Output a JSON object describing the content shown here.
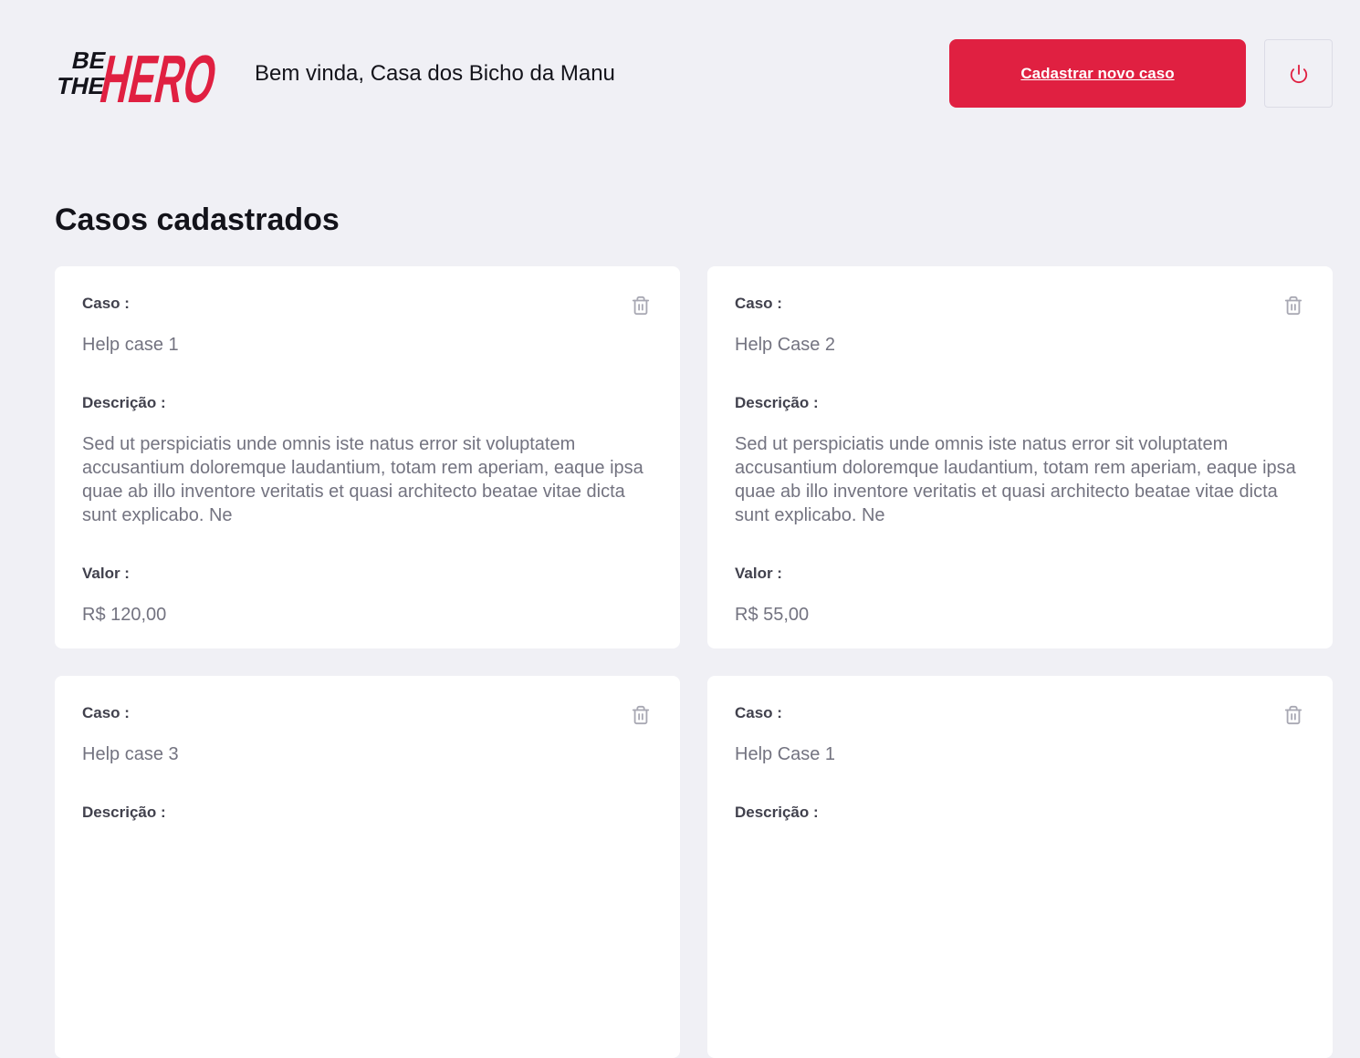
{
  "logo": {
    "line1": "BE",
    "line2": "THE",
    "line3": "HERO"
  },
  "header": {
    "welcome": "Bem vinda, Casa dos Bicho da Manu",
    "new_case_label": "Cadastrar novo caso",
    "logout_icon": "power-icon"
  },
  "page": {
    "title": "Casos cadastrados"
  },
  "cases": [
    {
      "case_label": "Caso :",
      "title": "Help case 1",
      "description_label": "Descrição :",
      "description": "Sed ut perspiciatis unde omnis iste natus error sit voluptatem accusantium doloremque laudantium, totam rem aperiam, eaque ipsa quae ab illo inventore veritatis et quasi architecto beatae vitae dicta sunt explicabo. Ne",
      "value_label": "Valor :",
      "value": "R$ 120,00"
    },
    {
      "case_label": "Caso :",
      "title": "Help Case 2",
      "description_label": "Descrição :",
      "description": "Sed ut perspiciatis unde omnis iste natus error sit voluptatem accusantium doloremque laudantium, totam rem aperiam, eaque ipsa quae ab illo inventore veritatis et quasi architecto beatae vitae dicta sunt explicabo. Ne",
      "value_label": "Valor :",
      "value": "R$ 55,00"
    },
    {
      "case_label": "Caso :",
      "title": "Help case 3",
      "description_label": "Descrição :"
    },
    {
      "case_label": "Caso :",
      "title": "Help Case 1",
      "description_label": "Descrição :"
    }
  ],
  "colors": {
    "background": "#f0f0f5",
    "accent": "#e02041",
    "card": "#ffffff",
    "label": "#41414d",
    "value_text": "#737380",
    "trash_icon": "#a8a8b3"
  },
  "icons": {
    "delete": "trash-icon"
  }
}
